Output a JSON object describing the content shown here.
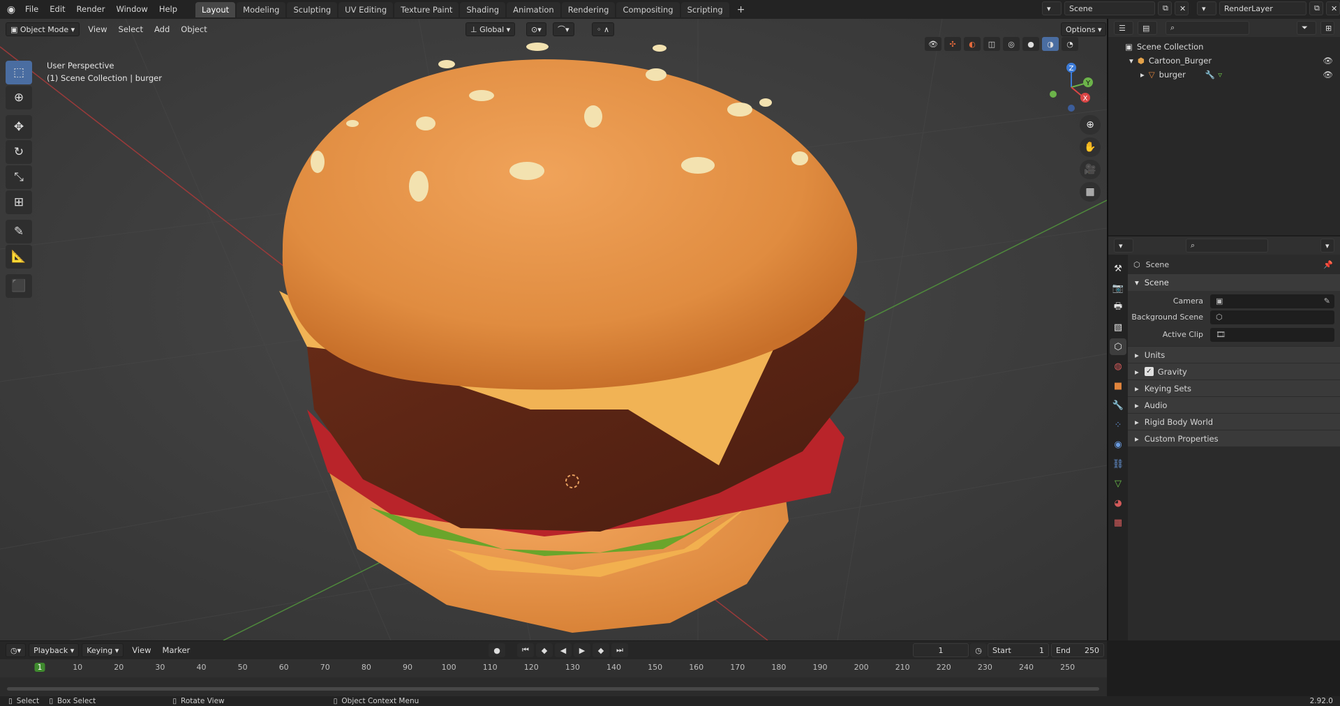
{
  "topbar": {
    "menus": [
      "File",
      "Edit",
      "Render",
      "Window",
      "Help"
    ],
    "workspaces": [
      {
        "label": "Layout",
        "active": true
      },
      {
        "label": "Modeling",
        "active": false
      },
      {
        "label": "Sculpting",
        "active": false
      },
      {
        "label": "UV Editing",
        "active": false
      },
      {
        "label": "Texture Paint",
        "active": false
      },
      {
        "label": "Shading",
        "active": false
      },
      {
        "label": "Animation",
        "active": false
      },
      {
        "label": "Rendering",
        "active": false
      },
      {
        "label": "Compositing",
        "active": false
      },
      {
        "label": "Scripting",
        "active": false
      }
    ],
    "add_tab": "+",
    "scene": "Scene",
    "render_layer": "RenderLayer"
  },
  "viewport_header": {
    "mode": "Object Mode",
    "menus": [
      "View",
      "Select",
      "Add",
      "Object"
    ],
    "orientation": "Global",
    "options": "Options"
  },
  "viewport": {
    "perspective": "User Perspective",
    "collection": "(1) Scene Collection | burger",
    "gizmo_axes": {
      "x": "X",
      "y": "Y",
      "z": "Z"
    }
  },
  "outliner": {
    "root": "Scene Collection",
    "collection": "Cartoon_Burger",
    "object": "burger"
  },
  "properties": {
    "breadcrumb": "Scene",
    "panel": "Scene",
    "fields": [
      {
        "label": "Camera",
        "value": ""
      },
      {
        "label": "Background Scene",
        "value": ""
      },
      {
        "label": "Active Clip",
        "value": ""
      }
    ],
    "subpanels": [
      "Units",
      "Gravity",
      "Keying Sets",
      "Audio",
      "Rigid Body World",
      "Custom Properties"
    ],
    "gravity_checked": true
  },
  "timeline": {
    "menus": [
      "Playback",
      "Keying",
      "View",
      "Marker"
    ],
    "current_frame": "1",
    "start_label": "Start",
    "start": "1",
    "end_label": "End",
    "end": "250",
    "ticks": [
      "1",
      "10",
      "20",
      "30",
      "40",
      "50",
      "60",
      "70",
      "80",
      "90",
      "100",
      "110",
      "120",
      "130",
      "140",
      "150",
      "160",
      "170",
      "180",
      "190",
      "200",
      "210",
      "220",
      "230",
      "240",
      "250"
    ]
  },
  "statusbar": {
    "select": "Select",
    "box_select": "Box Select",
    "rotate": "Rotate View",
    "context": "Object Context Menu",
    "version": "2.92.0"
  },
  "colors": {
    "accent": "#4a6da1",
    "active_frame": "#3f8a2e",
    "bun": "#e99a4e",
    "patty": "#5b2516",
    "cheese": "#f1b355",
    "tomato": "#b9242a",
    "lettuce": "#6aa52b"
  }
}
